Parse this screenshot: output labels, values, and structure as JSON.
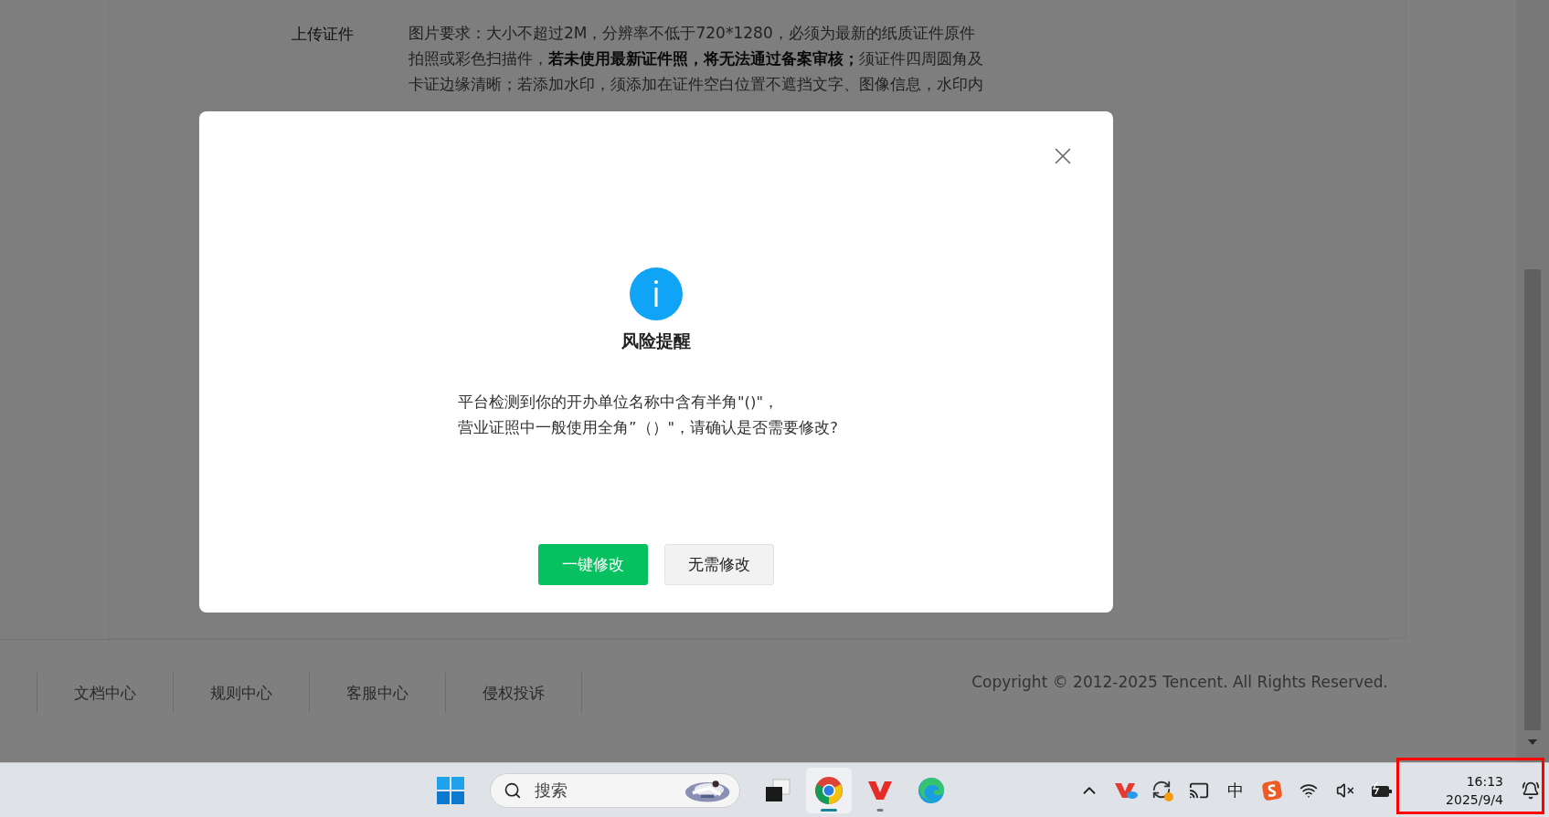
{
  "form": {
    "label": "上传证件",
    "requirement_lines": [
      "图片要求：大小不超过2M，分辨率不低于720*1280，必须为最新的纸质证件原件",
      "拍照或彩色扫描件，**若未使用最新证件照，将无法通过备案审核；**须证件四周圆角及",
      "卡证边缘清晰；若添加水印，须添加在证件空白位置不遮挡文字、图像信息，水印内"
    ]
  },
  "footer": {
    "links": [
      "文档中心",
      "规则中心",
      "客服中心",
      "侵权投诉"
    ],
    "copyright": "Copyright © 2012-2025 Tencent. All Rights Reserved."
  },
  "dialog": {
    "title": "风险提醒",
    "message_lines": [
      "平台检测到你的开办单位名称中含有半角\"()\"，",
      "营业证照中一般使用全角”（）\"，请确认是否需要修改?"
    ],
    "buttons": [
      {
        "label": "一键修改",
        "kind": "primary"
      },
      {
        "label": "无需修改",
        "kind": "secondary"
      }
    ]
  },
  "taskbar": {
    "search_placeholder": "搜索",
    "apps": [
      {
        "kind": "browser",
        "selected": true,
        "open": true
      },
      {
        "kind": "office",
        "selected": false,
        "open": true
      },
      {
        "kind": "edge",
        "selected": false,
        "open": false
      }
    ],
    "ime": "中",
    "time": "16:13",
    "date": "2025/9/4"
  }
}
